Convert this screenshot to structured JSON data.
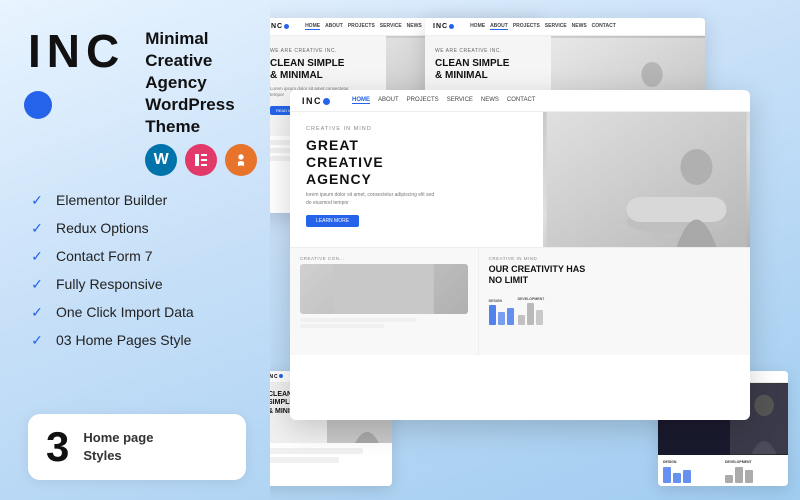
{
  "logo": {
    "text": "INC",
    "dot": "●"
  },
  "theme": {
    "title_line1": "Minimal Creative Agency",
    "title_line2": "WordPress Theme",
    "icons": [
      {
        "name": "wordpress-icon",
        "symbol": "W",
        "bg": "#0073aa"
      },
      {
        "name": "elementor-icon",
        "symbol": "E",
        "bg": "#e2396b"
      },
      {
        "name": "touch-icon",
        "symbol": "☞",
        "bg": "#e8732a"
      }
    ]
  },
  "features": [
    {
      "label": "Elementor Builder"
    },
    {
      "label": "Redux Options"
    },
    {
      "label": "Contact Form 7"
    },
    {
      "label": "Fully Responsive"
    },
    {
      "label": "One Click Import Data"
    },
    {
      "label": "03 Home Pages Style"
    }
  ],
  "badge": {
    "number": "3",
    "line1": "Home page",
    "line2": "Styles"
  },
  "mockups": {
    "nav_logo": "INC",
    "nav_links": [
      "HOME",
      "ABOUT",
      "PROJECTS",
      "SERVICE",
      "NEWS",
      "CONTACT"
    ],
    "hero_tag": "WE ARE CREATIVE INC.",
    "hero_title": "CLEAN SIMPLE\n& MINIMAL",
    "hero_text": "Lorem ipsum dolor sit amet consectetur tempor",
    "hero_btn": "READ MORE",
    "agency_tag": "CREATIVE IN MIND",
    "agency_title": "GREAT\nCREATIVE\nAGENCY",
    "agency_text": "lorem ipsum dolor sit amet, consectetur adipiscing elit sed do eiusmod tempor",
    "agency_btn": "LEARN MORE",
    "creativity_tag": "CREATIVE IN MIND",
    "creativity_title": "OUR CREATIVITY HAS\nNO LIMIT",
    "design_label": "DESIGN",
    "dev_label": "DEVELOPMENT"
  }
}
